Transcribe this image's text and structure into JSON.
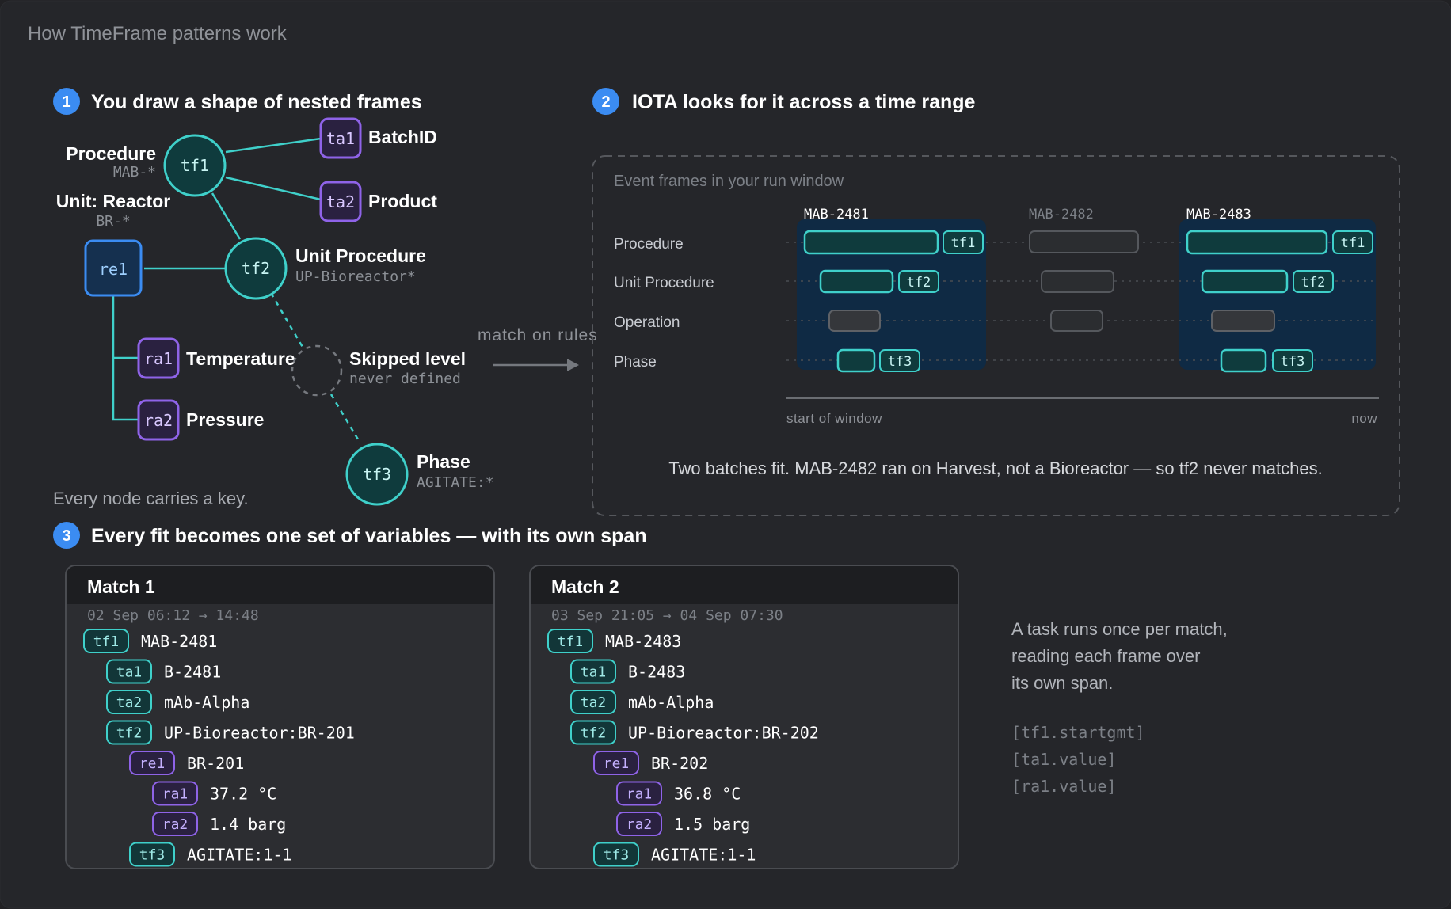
{
  "page": {
    "title": "How TimeFrame patterns work"
  },
  "section1": {
    "number": "1",
    "title": "You draw a shape of nested frames",
    "footer": "Every node carries a key.",
    "nodes": {
      "tf1": {
        "id": "tf1",
        "label": "Procedure",
        "sub": "MAB-*"
      },
      "tf2": {
        "id": "tf2",
        "label": "Unit Procedure",
        "sub": "UP-Bioreactor*"
      },
      "tf3": {
        "id": "tf3",
        "label": "Phase",
        "sub": "AGITATE:*"
      },
      "re1": {
        "id": "re1",
        "label": "Unit: Reactor",
        "sub": "BR-*"
      },
      "ta1": {
        "id": "ta1",
        "label": "BatchID"
      },
      "ta2": {
        "id": "ta2",
        "label": "Product"
      },
      "ra1": {
        "id": "ra1",
        "label": "Temperature"
      },
      "ra2": {
        "id": "ra2",
        "label": "Pressure"
      },
      "skipped": {
        "label": "Skipped level",
        "sub": "never defined"
      }
    }
  },
  "arrow": {
    "label": "match on rules"
  },
  "section2": {
    "number": "2",
    "title": "IOTA looks for it across a time range",
    "panel_title": "Event frames in your run window",
    "rows": [
      "Procedure",
      "Unit Procedure",
      "Operation",
      "Phase"
    ],
    "batches": [
      {
        "name": "MAB-2481",
        "matched": true
      },
      {
        "name": "MAB-2482",
        "matched": false
      },
      {
        "name": "MAB-2483",
        "matched": true
      }
    ],
    "chips": {
      "tf1": "tf1",
      "tf2": "tf2",
      "tf3": "tf3"
    },
    "axis": {
      "start": "start of window",
      "end": "now"
    },
    "caption": "Two batches fit. MAB-2482 ran on Harvest, not a Bioreactor — so tf2 never matches."
  },
  "section3": {
    "number": "3",
    "title": "Every fit becomes one set of variables — with its own span",
    "matches": [
      {
        "title": "Match 1",
        "span": "02 Sep 06:12 → 14:48",
        "rows": [
          {
            "key": "tf1",
            "value": "MAB-2481"
          },
          {
            "key": "ta1",
            "value": "B-2481"
          },
          {
            "key": "ta2",
            "value": "mAb-Alpha"
          },
          {
            "key": "tf2",
            "value": "UP-Bioreactor:BR-201"
          },
          {
            "key": "re1",
            "value": "BR-201"
          },
          {
            "key": "ra1",
            "value": "37.2 °C"
          },
          {
            "key": "ra2",
            "value": "1.4 barg"
          },
          {
            "key": "tf3",
            "value": "AGITATE:1-1"
          }
        ]
      },
      {
        "title": "Match 2",
        "span": "03 Sep 21:05 → 04 Sep 07:30",
        "rows": [
          {
            "key": "tf1",
            "value": "MAB-2483"
          },
          {
            "key": "ta1",
            "value": "B-2483"
          },
          {
            "key": "ta2",
            "value": "mAb-Alpha"
          },
          {
            "key": "tf2",
            "value": "UP-Bioreactor:BR-202"
          },
          {
            "key": "re1",
            "value": "BR-202"
          },
          {
            "key": "ra1",
            "value": "36.8 °C"
          },
          {
            "key": "ra2",
            "value": "1.5 barg"
          },
          {
            "key": "tf3",
            "value": "AGITATE:1-1"
          }
        ]
      }
    ],
    "side_text": [
      "A task runs once per match,",
      "reading each frame over",
      "its own span."
    ],
    "side_code": [
      "[tf1.startgmt]",
      "[ta1.value]",
      "[ra1.value]"
    ]
  },
  "colors": {
    "background": "#212124",
    "teal": "#3fd0ca",
    "purple": "#8f63e8",
    "blue": "#3b8cf2",
    "match_highlight": "#0f2a44"
  }
}
